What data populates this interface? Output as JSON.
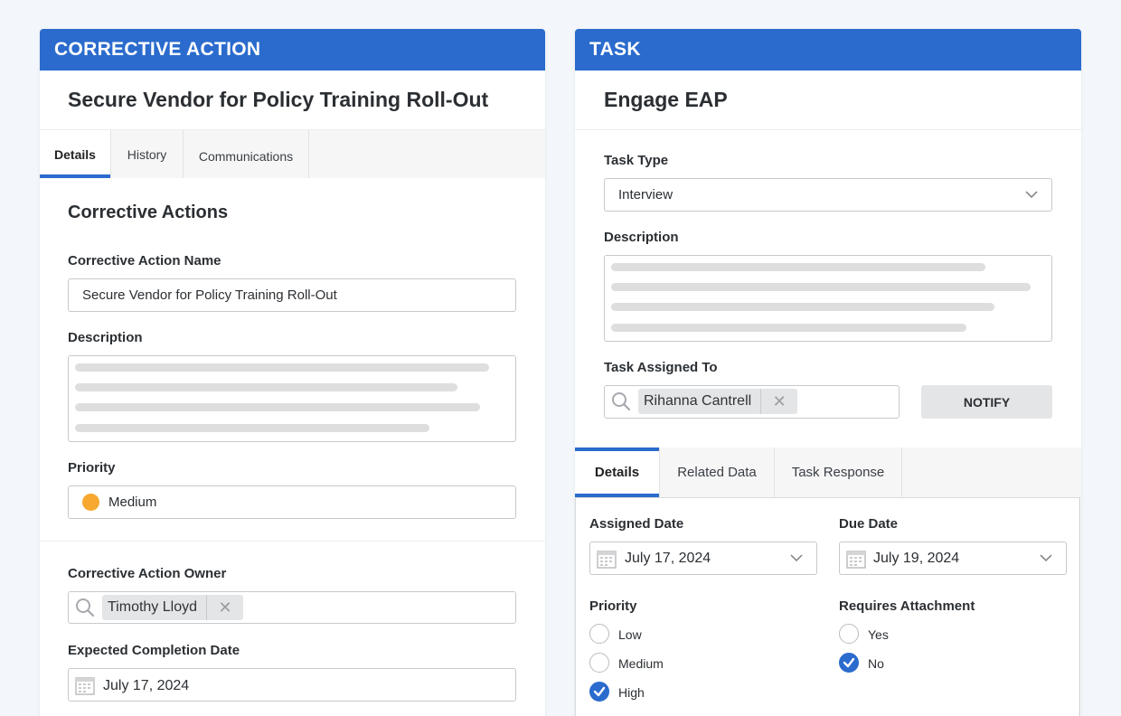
{
  "left": {
    "header": "CORRECTIVE ACTION",
    "title": "Secure Vendor for Policy Training Roll-Out",
    "tabs": [
      "Details",
      "History",
      "Communications"
    ],
    "section_title": "Corrective Actions",
    "name_label": "Corrective Action Name",
    "name_value": "Secure Vendor for Policy Training Roll-Out",
    "description_label": "Description",
    "priority_label": "Priority",
    "priority_value": "Medium",
    "priority_color": "#f7a82e",
    "owner_label": "Corrective Action Owner",
    "owner_value": "Timothy Lloyd",
    "completion_label": "Expected Completion Date",
    "completion_value": "July 17, 2024"
  },
  "right": {
    "header": "TASK",
    "title": "Engage EAP",
    "task_type_label": "Task Type",
    "task_type_value": "Interview",
    "description_label": "Description",
    "assigned_to_label": "Task Assigned To",
    "assigned_to_value": "Rihanna Cantrell",
    "notify_label": "NOTIFY",
    "tabs": [
      "Details",
      "Related Data",
      "Task Response"
    ],
    "assigned_date_label": "Assigned Date",
    "assigned_date_value": "July 17, 2024",
    "due_date_label": "Due Date",
    "due_date_value": "July 19, 2024",
    "priority_label": "Priority",
    "priority_options": [
      "Low",
      "Medium",
      "High"
    ],
    "priority_selected": "High",
    "attachment_label": "Requires Attachment",
    "attachment_options": [
      "Yes",
      "No"
    ],
    "attachment_selected": "No"
  },
  "colors": {
    "accent": "#2a6bcd",
    "background": "#f3f6fa",
    "button": "#e4e5e7"
  }
}
